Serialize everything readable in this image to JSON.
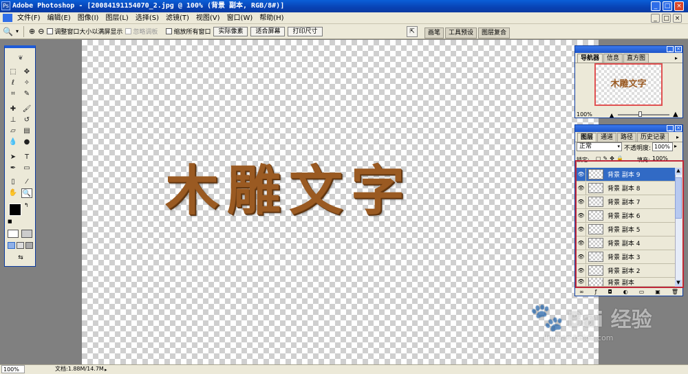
{
  "app": {
    "title": "Adobe Photoshop - [20084191154070_2.jpg @ 100% (背景 副本, RGB/8#)]",
    "window_buttons": [
      "_",
      "□",
      "×"
    ]
  },
  "menu": [
    "文件(F)",
    "编辑(E)",
    "图像(I)",
    "图层(L)",
    "选择(S)",
    "滤镜(T)",
    "视图(V)",
    "窗口(W)",
    "帮助(H)"
  ],
  "options": {
    "tool_icon": "zoom-tool-icon",
    "check_resize": "调整窗口大小以满屏显示",
    "check_ignore_palettes": "忽略调板",
    "check_zoom_all": "缩放所有窗口",
    "btn_actual": "实际像素",
    "btn_fit": "适合屏幕",
    "btn_print": "打印尺寸",
    "palette_well": [
      "画笔",
      "工具预设",
      "图层复合"
    ]
  },
  "canvas": {
    "text": "木雕文字"
  },
  "navigator": {
    "tabs": [
      "导航器",
      "信息",
      "直方图"
    ],
    "thumb_text": "木雕文字",
    "zoom": "100%"
  },
  "layers": {
    "tabs": [
      "图层",
      "通道",
      "路径",
      "历史记录"
    ],
    "blend_mode": "正常",
    "opacity_label": "不透明度:",
    "opacity": "100%",
    "lock_label": "锁定:",
    "fill_label": "填充:",
    "fill": "100%",
    "items": [
      "背景 副本 9",
      "背景 副本 8",
      "背景 副本 7",
      "背景 副本 6",
      "背景 副本 5",
      "背景 副本 4",
      "背景 副本 3",
      "背景 副本 2",
      "背景 副本"
    ],
    "selected_index": 0
  },
  "status": {
    "zoom": "100%",
    "doc": "文档:1.88M/14.7M"
  },
  "watermark": "Bai 经验",
  "watermark_url": "jingyan.baidu.com",
  "colors": {
    "accent_blue": "#0a5fd8",
    "selection": "#316ac5",
    "wood": "#9a5a22",
    "highlight_box": "#c0283a"
  }
}
